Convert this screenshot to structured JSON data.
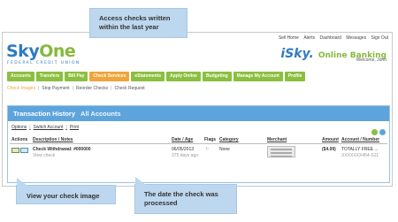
{
  "top_links": [
    "Sell Home",
    "Alerts",
    "Dashboard",
    "Messages",
    "Sign Out"
  ],
  "logo": {
    "part1": "Sky",
    "part2": "One",
    "subtitle": "FEDERAL CREDIT UNION"
  },
  "brand": {
    "i": "iSky.",
    "online": "Online Banking"
  },
  "welcome": "Welcome, John",
  "nav": [
    {
      "label": "Accounts"
    },
    {
      "label": "Transfers"
    },
    {
      "label": "Bill Pay"
    },
    {
      "label": "Check Services",
      "active": true
    },
    {
      "label": "eStatements"
    },
    {
      "label": "Apply Online"
    },
    {
      "label": "Budgeting"
    },
    {
      "label": "Manage My Account"
    },
    {
      "label": "Profile"
    }
  ],
  "subnav": [
    "Check Images",
    "Stop Payment",
    "Reorder Checks",
    "Check Request"
  ],
  "panel": {
    "title": "Transaction History",
    "account": "All Accounts",
    "options": [
      "Options",
      "Switch Account",
      "Print"
    ],
    "columns": [
      "Actions",
      "Description / Notes",
      "Date / Age",
      "Flags",
      "Category",
      "Merchant",
      "Amount",
      "Account / Number"
    ],
    "row": {
      "description": "Check Withdrawal: #000000",
      "link": "View check",
      "date": "06/05/2013",
      "age": "375 days ago",
      "category": "None",
      "amount": "($4.09)",
      "account": "TOTALLY FREE ...",
      "account_number": "XXXXXXX454-S11"
    }
  },
  "callouts": {
    "top": "Access checks written within the last year",
    "bottom_left": "View your check image",
    "bottom_mid": "The date the check was processed"
  },
  "colors": {
    "green": "#8cbf3f",
    "orange": "#f0a43a",
    "blue": "#5ea4dc",
    "callout": "#bdd7ee"
  }
}
